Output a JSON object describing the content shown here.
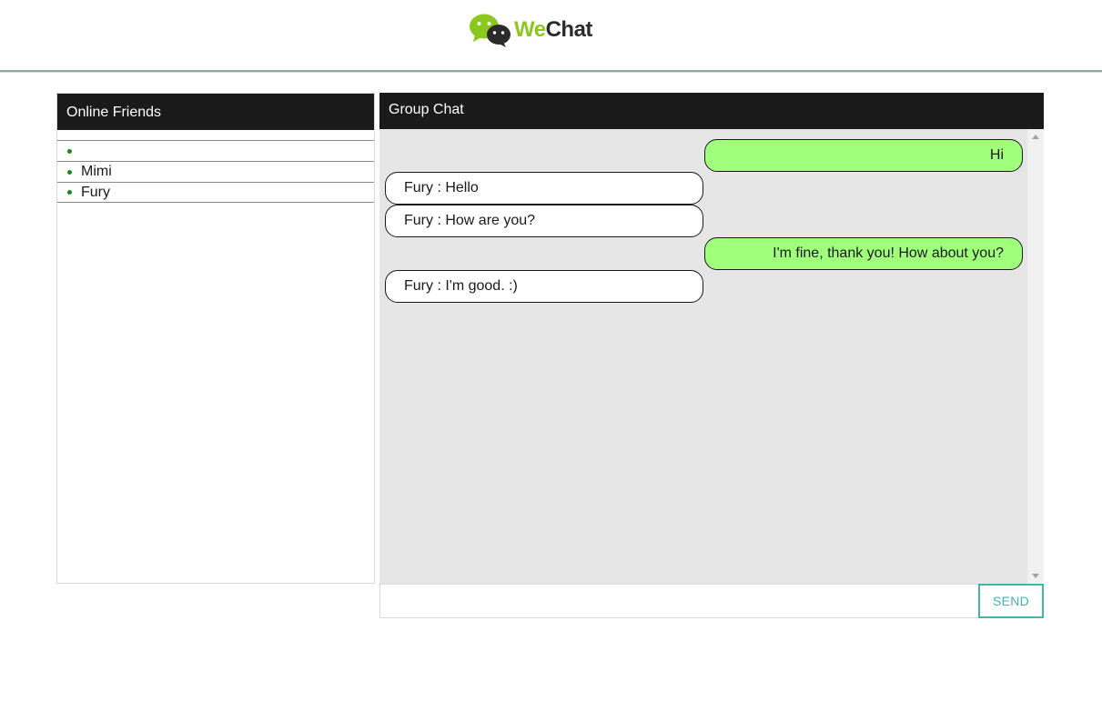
{
  "header": {
    "logo_part1": "We",
    "logo_part2": "Chat",
    "logo_icon": "wechat-bubbles-icon"
  },
  "friends_panel": {
    "title": "Online Friends",
    "items": [
      {
        "label": ""
      },
      {
        "label": "Mimi"
      },
      {
        "label": "Fury"
      }
    ]
  },
  "chat_panel": {
    "title": "Group Chat",
    "messages": [
      {
        "direction": "outgoing",
        "text": "Hi"
      },
      {
        "direction": "incoming",
        "text": "Fury : Hello"
      },
      {
        "direction": "incoming",
        "text": "Fury : How are you?"
      },
      {
        "direction": "outgoing",
        "text": "I'm fine, thank you! How about you?"
      },
      {
        "direction": "incoming",
        "text": "Fury : I'm good. :)"
      }
    ],
    "input_value": "",
    "send_label": "SEND"
  },
  "colors": {
    "outgoing_bubble": "#a0ff7b",
    "incoming_bubble": "#ffffff",
    "panel_header": "#1a1a1a",
    "chat_background": "#e6e6e6",
    "send_accent": "#3fb5ad",
    "online_dot": "#1a8a1a",
    "logo_green": "#8bc81e"
  }
}
